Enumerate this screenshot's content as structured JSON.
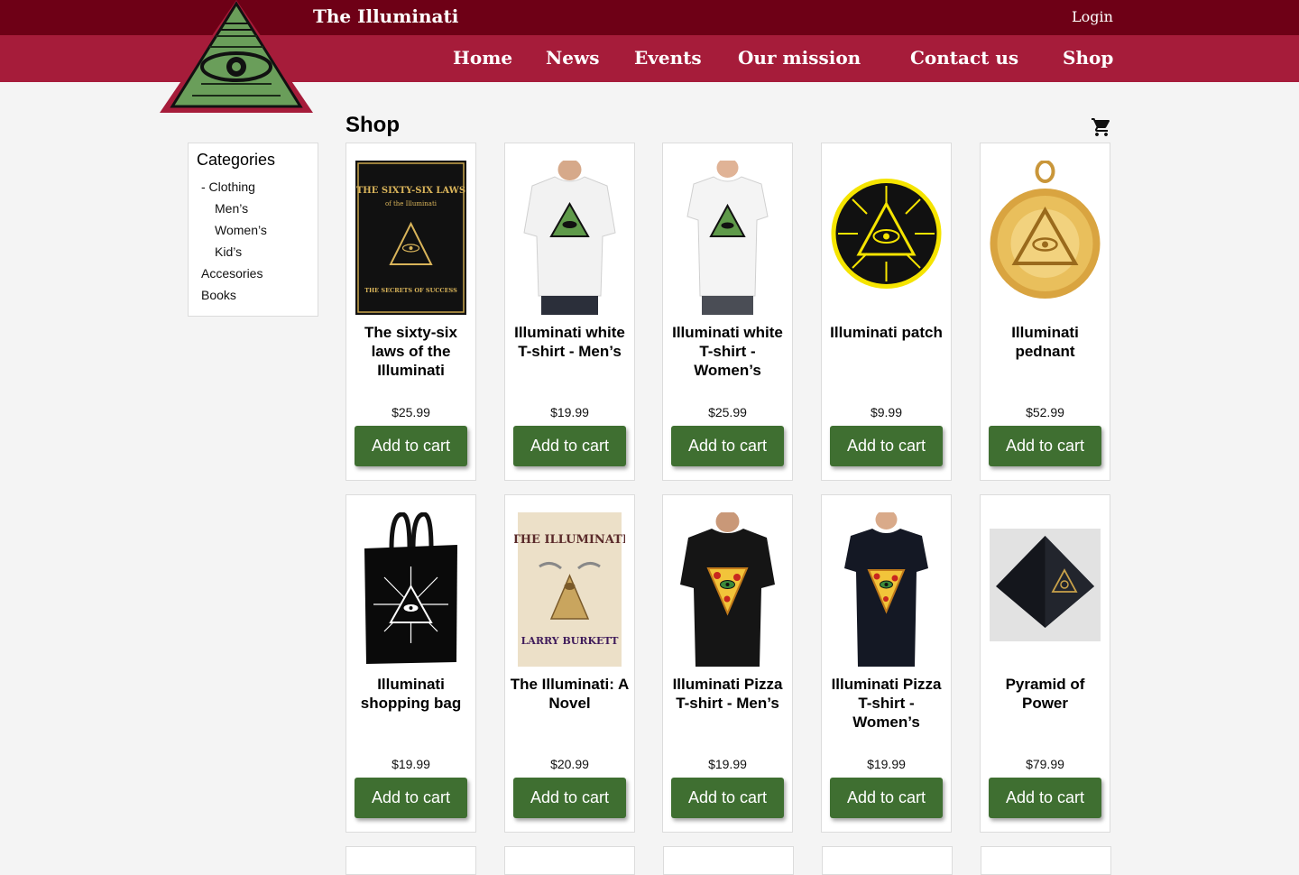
{
  "header": {
    "site_title": "The Illuminati",
    "login_label": "Login",
    "nav": [
      "Home",
      "News",
      "Events",
      "Our mission",
      "Contact us",
      "Shop"
    ]
  },
  "page_title": "Shop",
  "categories": {
    "title": "Categories",
    "items": [
      "- Clothing",
      "Men’s",
      "Women’s",
      "Kid’s",
      "Accesories",
      "Books"
    ]
  },
  "add_to_cart_label": "Add to cart",
  "products": [
    {
      "name": "The sixty-six laws of the Illuminati",
      "price": "$25.99",
      "book_title": "THE SIXTY-SIX LAWS",
      "book_subtitle": "of the Illuminati",
      "book_footer": "THE SECRETS OF SUCCESS"
    },
    {
      "name": "Illuminati white T-shirt - Men’s",
      "price": "$19.99"
    },
    {
      "name": "Illuminati white T-shirt - Women’s",
      "price": "$25.99"
    },
    {
      "name": "Illuminati patch",
      "price": "$9.99"
    },
    {
      "name": "Illuminati pednant",
      "price": "$52.99"
    },
    {
      "name": "Illuminati shopping bag",
      "price": "$19.99"
    },
    {
      "name": "The Illuminati: A Novel",
      "price": "$20.99",
      "book_title": "THE ILLUMINATI",
      "book_author": "LARRY BURKETT"
    },
    {
      "name": "Illuminati Pizza T-shirt - Men’s",
      "price": "$19.99"
    },
    {
      "name": "Illuminati Pizza T-shirt - Women’s",
      "price": "$19.99"
    },
    {
      "name": "Pyramid of Power",
      "price": "$79.99"
    }
  ],
  "colors": {
    "topbar": "#6e0016",
    "navbar": "#a61c3a",
    "button": "#3f6f31",
    "logo_green": "#6a9e5a"
  },
  "icons": {
    "logo": "all-seeing-eye-pyramid-icon",
    "cart": "shopping-cart-icon"
  }
}
